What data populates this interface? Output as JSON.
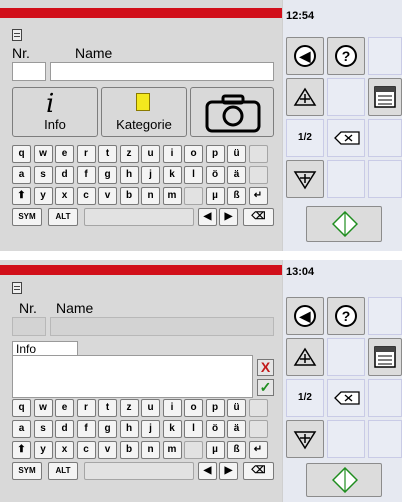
{
  "screen1": {
    "clock": "12:54",
    "labels": {
      "nr": "Nr.",
      "name": "Name"
    },
    "fields": {
      "nr_value": "",
      "name_value": ""
    },
    "buttons": {
      "info": "Info",
      "kategorie": "Kategorie"
    },
    "icons": {
      "info": "info-icon",
      "kategorie": "folder-icon",
      "camera": "camera-icon"
    }
  },
  "screen2": {
    "clock": "13:04",
    "labels": {
      "nr": "Nr.",
      "name": "Name"
    },
    "tab_label": "Info",
    "textarea_value": "",
    "cancel_glyph": "X",
    "confirm_glyph": "✓"
  },
  "keyboard": {
    "row1": [
      "q",
      "w",
      "e",
      "r",
      "t",
      "z",
      "u",
      "i",
      "o",
      "p",
      "ü",
      ""
    ],
    "row2": [
      "a",
      "s",
      "d",
      "f",
      "g",
      "h",
      "j",
      "k",
      "l",
      "ö",
      "ä",
      ""
    ],
    "row3": [
      "⬆",
      "y",
      "x",
      "c",
      "v",
      "b",
      "n",
      "m",
      "",
      "µ",
      "ß",
      "↵"
    ],
    "sym": "SYM",
    "alt": "ALT",
    "left_arrow": "◀",
    "right_arrow": "▶",
    "backspace": "⌫"
  },
  "side_panel": {
    "page": "1/2",
    "icons": [
      "back-arrow-icon",
      "help-icon",
      "add-icon",
      "list-icon",
      "backspace-icon",
      "remove-icon",
      "confirm-diamond-icon"
    ]
  },
  "colors": {
    "brand_red": "#d10f1a",
    "cancel_red": "#c21a1a",
    "confirm_green": "#1f8d1f",
    "panel_bg": "#d9d9d9",
    "side_bg": "#e6e9f1"
  }
}
